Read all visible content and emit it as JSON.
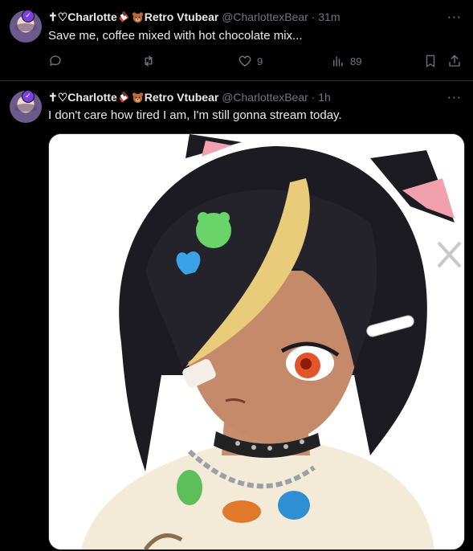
{
  "tweets": [
    {
      "display_name_1": "✝♡Charlotte",
      "display_name_2": "Retro Vtubear",
      "handle": "@CharlottexBear",
      "separator": "·",
      "time": "31m",
      "text": "Save me, coffee mixed with hot chocolate mix...",
      "likes": "9",
      "views": "89"
    },
    {
      "display_name_1": "✝♡Charlotte",
      "display_name_2": "Retro Vtubear",
      "handle": "@CharlottexBear",
      "separator": "·",
      "time": "1h",
      "text": "I don't care how tired I am, I'm still gonna stream today."
    }
  ],
  "more_glyph": "···",
  "verified_glyph": "✓",
  "icons": [
    "reply-icon",
    "retweet-icon",
    "heart-icon",
    "views-icon",
    "bookmark-icon",
    "share-icon",
    "chocolate-emoji-icon",
    "bear-emoji-icon"
  ],
  "colors": {
    "background": "#000000",
    "text": "#e7e9ea",
    "muted": "#71767b",
    "divider": "#2f3336",
    "badge": "#7b3fe4"
  }
}
